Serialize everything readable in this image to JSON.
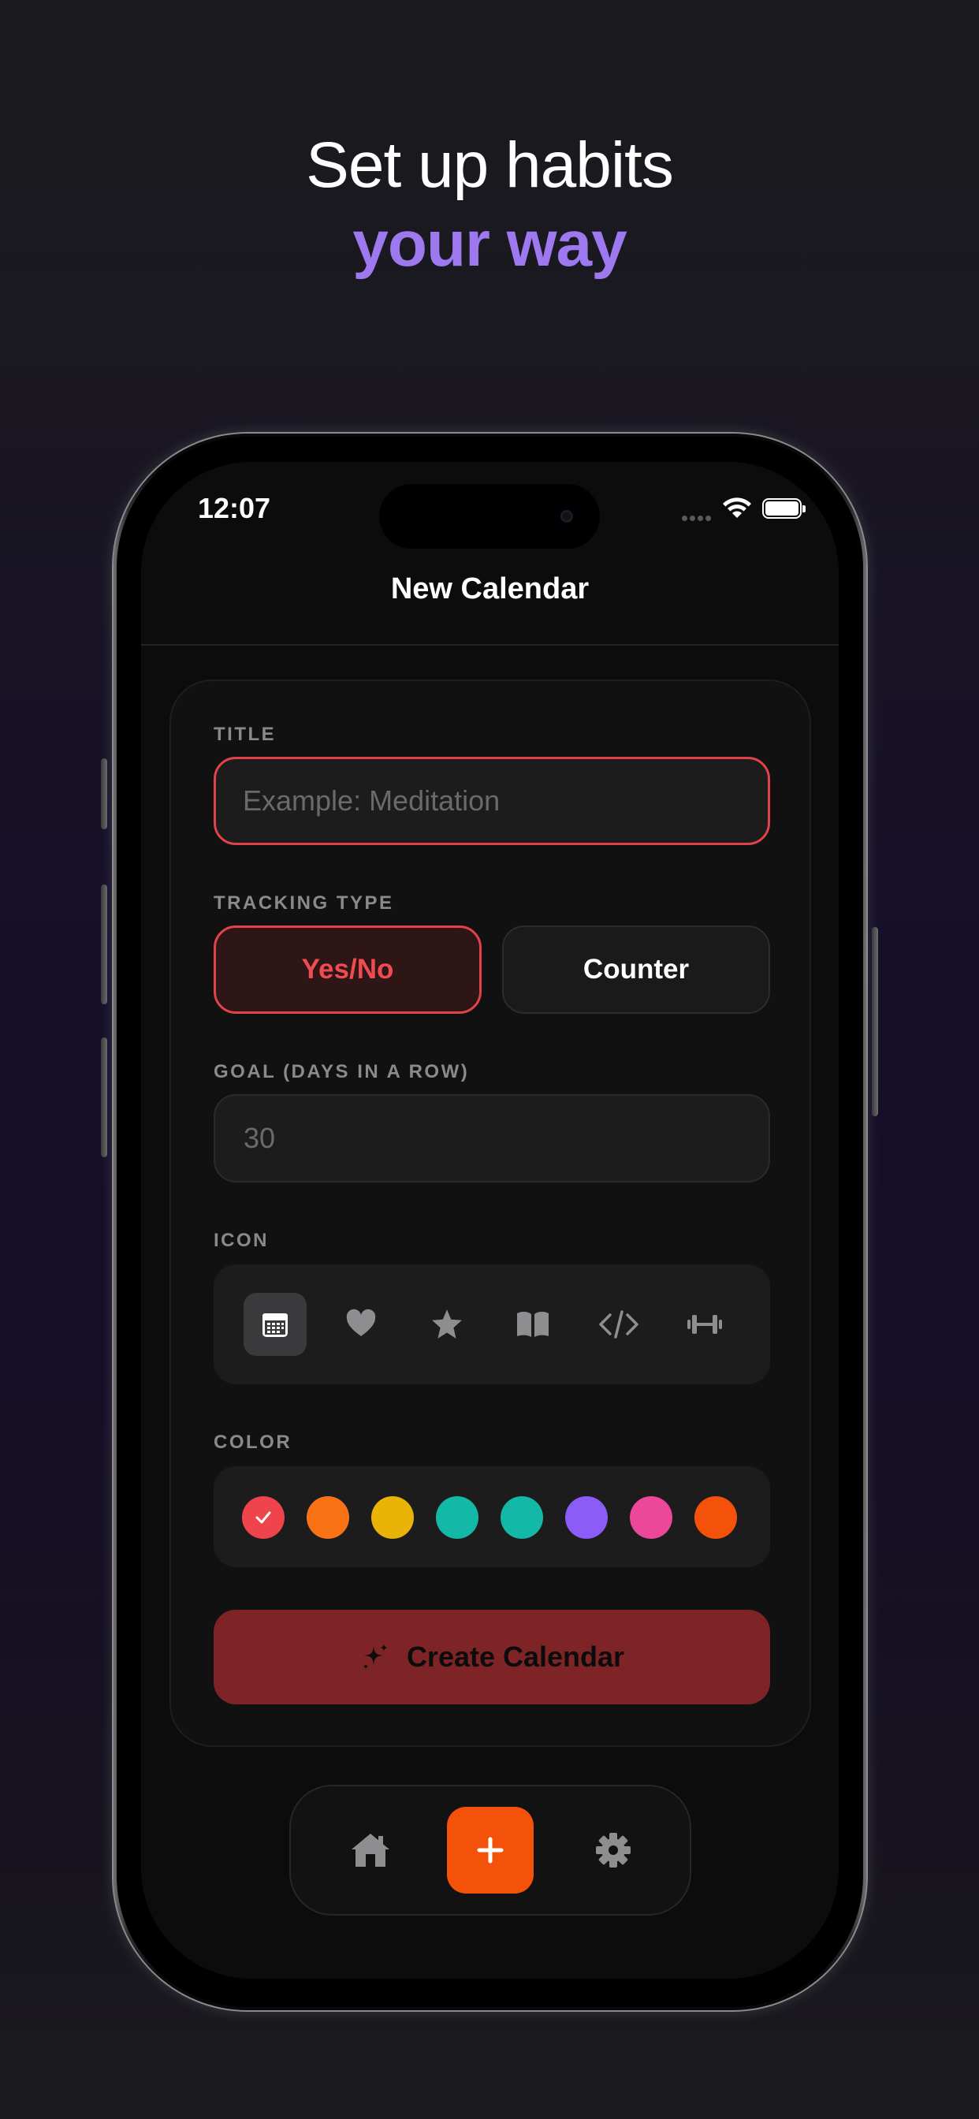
{
  "headline": {
    "line1": "Set up habits",
    "line2": "your way"
  },
  "status_bar": {
    "time": "12:07"
  },
  "nav": {
    "title": "New Calendar"
  },
  "form": {
    "title_label": "TITLE",
    "title_placeholder": "Example: Meditation",
    "tracking_label": "TRACKING TYPE",
    "tracking_options": [
      {
        "label": "Yes/No",
        "selected": true
      },
      {
        "label": "Counter",
        "selected": false
      }
    ],
    "goal_label": "GOAL (DAYS IN A ROW)",
    "goal_placeholder": "30",
    "icon_label": "ICON",
    "icons": [
      {
        "name": "calendar-icon",
        "selected": true
      },
      {
        "name": "heart-icon",
        "selected": false
      },
      {
        "name": "star-icon",
        "selected": false
      },
      {
        "name": "book-icon",
        "selected": false
      },
      {
        "name": "code-icon",
        "selected": false
      },
      {
        "name": "dumbbell-icon",
        "selected": false
      }
    ],
    "color_label": "COLOR",
    "colors": [
      {
        "hex": "#ef444c",
        "selected": true
      },
      {
        "hex": "#f97316",
        "selected": false
      },
      {
        "hex": "#eab308",
        "selected": false
      },
      {
        "hex": "#14b8a6",
        "selected": false
      },
      {
        "hex": "#14b8a6",
        "selected": false
      },
      {
        "hex": "#8b5cf6",
        "selected": false
      },
      {
        "hex": "#ec4899",
        "selected": false
      },
      {
        "hex": "#f4520a",
        "selected": false
      }
    ],
    "create_button": "Create Calendar"
  },
  "tabbar": {
    "items": [
      {
        "name": "home-icon"
      },
      {
        "name": "plus-icon",
        "active": true
      },
      {
        "name": "gear-icon"
      }
    ]
  },
  "theme": {
    "accent": "#e0434a",
    "brand_purple": "#9d78ee",
    "tab_accent": "#f4520a"
  }
}
